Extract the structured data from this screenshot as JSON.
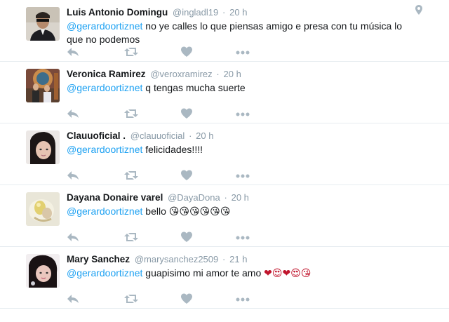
{
  "tweets": [
    {
      "fullname": "Luis Antonio Domingu",
      "username": "@ingladl19",
      "time": "20 h",
      "mention": "@gerardoortiznet",
      "text": "  no ye calles lo que piensas amigo e presa con tu música lo que no podemos",
      "emoji": ""
    },
    {
      "fullname": "Veronica Ramirez",
      "username": "@veroxramirez",
      "time": "20 h",
      "mention": "@gerardoortiznet",
      "text": " q tengas mucha suerte",
      "emoji": ""
    },
    {
      "fullname": "Clauuoficial .",
      "username": "@clauuoficial",
      "time": "20 h",
      "mention": "@gerardoortiznet",
      "text": "  felicidades!!!!",
      "emoji": ""
    },
    {
      "fullname": "Dayana Donaire varel",
      "username": "@DayaDona",
      "time": "20 h",
      "mention": "@gerardoortiznet",
      "text": " bello ",
      "emoji": "😘😘😘😘😘😘"
    },
    {
      "fullname": "Mary Sanchez",
      "username": "@marysanchez2509",
      "time": "21 h",
      "mention": "@gerardoortiznet",
      "text": " guapisimo mi amor te amo ",
      "emoji": "❤😍❤😍😘"
    }
  ],
  "separator": "·",
  "icons": {
    "reply": "reply-icon",
    "retweet": "retweet-icon",
    "like": "heart-icon",
    "more": "more-icon",
    "geo": "location-pin-icon"
  },
  "colors": {
    "mention": "#1da1f2",
    "secondary": "#8899a6",
    "action_icon": "#aab8c2",
    "divider": "#e6ecf0"
  }
}
